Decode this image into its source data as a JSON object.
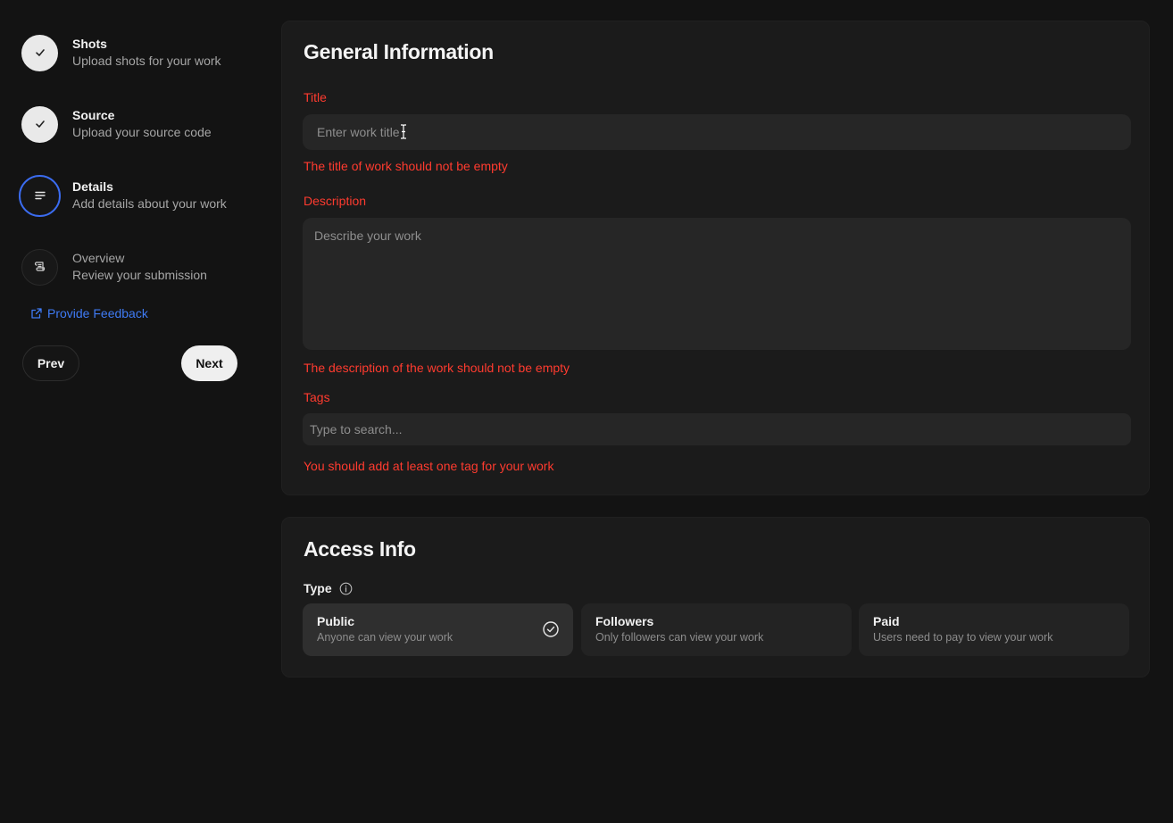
{
  "steps": [
    {
      "title": "Shots",
      "subtitle": "Upload shots for your work",
      "state": "done",
      "icon": "check-icon"
    },
    {
      "title": "Source",
      "subtitle": "Upload your source code",
      "state": "done",
      "icon": "check-icon"
    },
    {
      "title": "Details",
      "subtitle": "Add details about your work",
      "state": "active",
      "icon": "text-lines-icon"
    },
    {
      "title": "Overview",
      "subtitle": "Review your submission",
      "state": "pending",
      "icon": "scroll-icon"
    }
  ],
  "feedback": {
    "label": "Provide Feedback",
    "icon": "external-link-icon"
  },
  "nav": {
    "prev": "Prev",
    "next": "Next"
  },
  "general": {
    "heading": "General Information",
    "title_label": "Title",
    "title_placeholder": "Enter work title",
    "title_error": "The title of work should not be empty",
    "description_label": "Description",
    "description_placeholder": "Describe your work",
    "description_error": "The description of the work should not be empty",
    "tags_label": "Tags",
    "tags_placeholder": "Type to search...",
    "tags_error": "You should add at least one tag for your work"
  },
  "access": {
    "heading": "Access Info",
    "type_label": "Type",
    "options": [
      {
        "title": "Public",
        "subtitle": "Anyone can view your work",
        "selected": true
      },
      {
        "title": "Followers",
        "subtitle": "Only followers can view your work",
        "selected": false
      },
      {
        "title": "Paid",
        "subtitle": "Users need to pay to view your work",
        "selected": false
      }
    ]
  },
  "colors": {
    "error": "#ff3b2f",
    "accent": "#3b6cf0",
    "link": "#3f7bf5",
    "background": "#131313"
  }
}
